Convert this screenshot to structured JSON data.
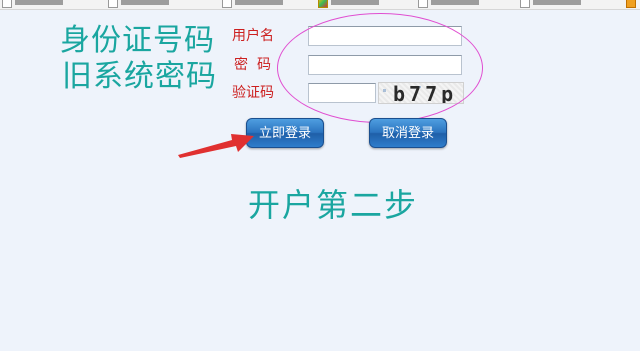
{
  "annotation": {
    "line1": "身份证号码",
    "line2": "旧系统密码"
  },
  "form": {
    "username_label": "用户名",
    "password_label": "密码",
    "captcha_label": "验证码",
    "username_value": "",
    "password_value": "",
    "captcha_value": "",
    "captcha_image_text": "b77p"
  },
  "buttons": {
    "login_label": "立即登录",
    "cancel_label": "取消登录"
  },
  "step_title": "开户第二步",
  "colors": {
    "annotation": "#1aa6a0",
    "label": "#cc1f1f",
    "ellipse": "#e04fd1",
    "arrow": "#e03030",
    "button": "#2b74bf",
    "background": "#eef3fb"
  }
}
